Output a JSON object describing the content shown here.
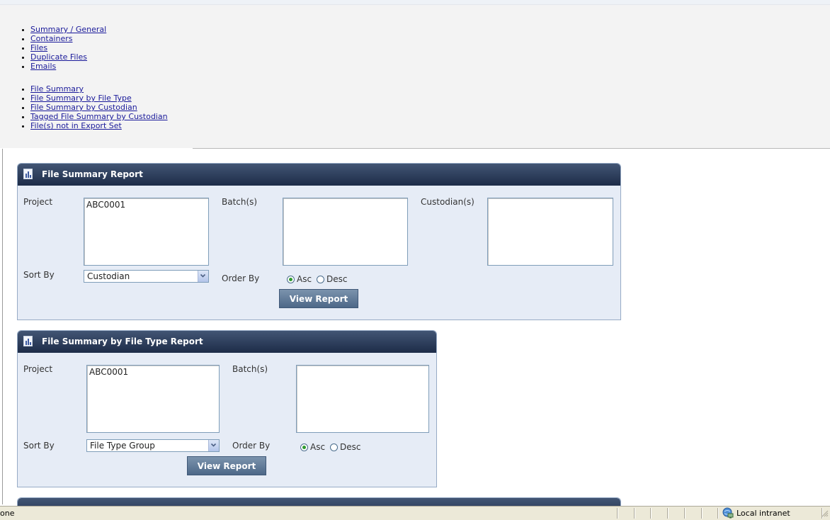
{
  "nav": {
    "primary": [
      "Summary / General",
      "Containers",
      "Files",
      "Duplicate Files",
      "Emails"
    ],
    "secondary": [
      "File Summary",
      "File Summary by File Type",
      "File Summary by Custodian",
      "Tagged File Summary by Custodian",
      "File(s) not in Export Set"
    ]
  },
  "panels": {
    "file_summary": {
      "title": "File Summary Report",
      "project_label": "Project",
      "project_value": "ABC0001",
      "batch_label": "Batch(s)",
      "custodian_label": "Custodian(s)",
      "sort_label": "Sort By",
      "sort_value": "Custodian",
      "order_label": "Order By",
      "asc_label": "Asc",
      "desc_label": "Desc",
      "selected_order": "Asc",
      "button": "View Report"
    },
    "file_type": {
      "title": "File Summary by File Type Report",
      "project_label": "Project",
      "project_value": "ABC0001",
      "batch_label": "Batch(s)",
      "sort_label": "Sort By",
      "sort_value": "File Type Group",
      "order_label": "Order By",
      "asc_label": "Asc",
      "desc_label": "Desc",
      "selected_order": "Asc",
      "button": "View Report"
    }
  },
  "status_bar": {
    "text": "one",
    "zone": "Local intranet"
  },
  "colors": {
    "header_top": "#425574",
    "header_bottom": "#1d2c48",
    "panel_bg": "#e6ecf6",
    "link": "#1a1a9a",
    "button": "#5c7797"
  }
}
